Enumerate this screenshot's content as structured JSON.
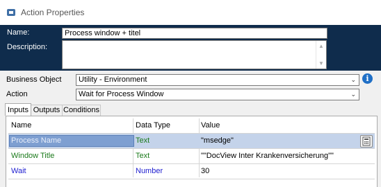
{
  "window": {
    "title": "Action Properties"
  },
  "header": {
    "name_label": "Name:",
    "name_value": "Process window + titel",
    "description_label": "Description:",
    "description_value": ""
  },
  "form": {
    "business_object_label": "Business Object",
    "business_object_value": "Utility - Environment",
    "action_label": "Action",
    "action_value": "Wait for Process Window"
  },
  "tabs": [
    {
      "label": "Inputs",
      "active": true
    },
    {
      "label": "Outputs",
      "active": false
    },
    {
      "label": "Conditions",
      "active": false
    }
  ],
  "grid": {
    "columns": [
      "Name",
      "Data Type",
      "Value"
    ],
    "rows": [
      {
        "name": "Process Name",
        "type": "Text",
        "value": "\"msedge\"",
        "selected": true,
        "color": "#1b7a1b"
      },
      {
        "name": "Window Title",
        "type": "Text",
        "value": "\"\"DocView Inter Krankenversicherung\"\"",
        "selected": false,
        "color": "#1b7a1b"
      },
      {
        "name": "Wait",
        "type": "Number",
        "value": "30",
        "selected": false,
        "color": "#2020d0"
      }
    ]
  },
  "colors": {
    "header_bg": "#0f2c4c",
    "text_type": "#1b7a1b",
    "number_type": "#2020d0",
    "selection": "#c4d3ea"
  },
  "icons": {
    "title": "action-icon",
    "info": "info-icon",
    "calculator": "calculator-icon"
  }
}
